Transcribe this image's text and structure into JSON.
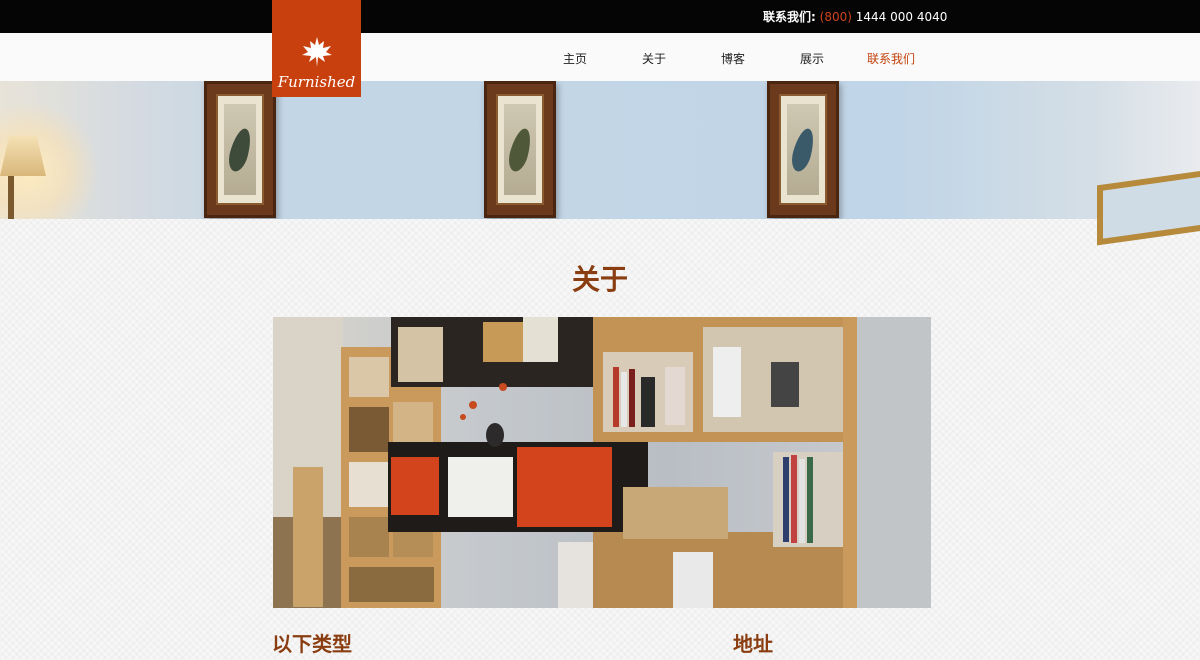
{
  "header": {
    "contact_label": "联系我们:",
    "contact_code": "(800)",
    "contact_number": "1444 000 4040"
  },
  "logo": {
    "text": "Furnished",
    "icon": "maple-leaf-icon"
  },
  "nav": {
    "items": [
      {
        "label": "主页",
        "active": false
      },
      {
        "label": "关于",
        "active": false
      },
      {
        "label": "博客",
        "active": false
      },
      {
        "label": "展示",
        "active": false
      },
      {
        "label": "联系我们",
        "active": true
      }
    ]
  },
  "about": {
    "title": "关于",
    "left_heading": "以下类型",
    "right_heading": "地址"
  },
  "colors": {
    "accent": "#c8400e",
    "heading": "#8a3d10",
    "topbar": "#050505",
    "cabinet_door": "#d3441c"
  }
}
